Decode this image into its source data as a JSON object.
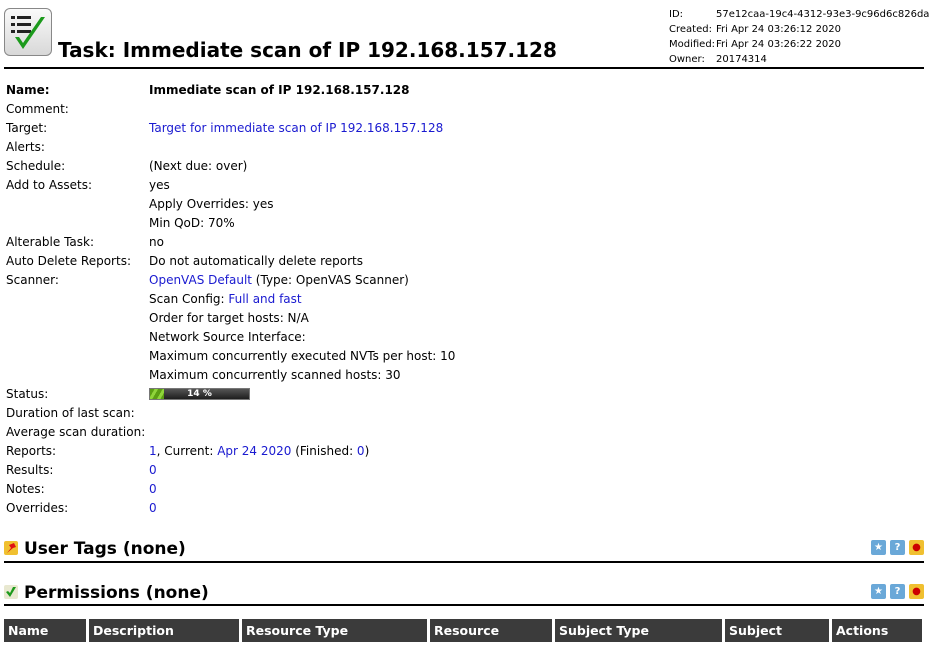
{
  "title": "Task: Immediate scan of IP 192.168.157.128",
  "meta": [
    {
      "label": "ID:",
      "value": "57e12caa-19c4-4312-93e3-9c96d6c826da"
    },
    {
      "label": "Created:",
      "value": "Fri Apr 24 03:26:12 2020"
    },
    {
      "label": "Modified:",
      "value": "Fri Apr 24 03:26:22 2020"
    },
    {
      "label": "Owner:",
      "value": "20174314"
    }
  ],
  "rows": [
    {
      "label": "Name:",
      "bold": true,
      "parts": [
        {
          "text": "Immediate scan of IP 192.168.157.128"
        }
      ]
    },
    {
      "label": "Comment:",
      "parts": []
    },
    {
      "label": "Target:",
      "parts": [
        {
          "text": "Target for immediate scan of IP 192.168.157.128",
          "link": true
        }
      ]
    },
    {
      "label": "Alerts:",
      "parts": []
    },
    {
      "label": "Schedule:",
      "parts": [
        {
          "text": "(Next due: over)"
        }
      ]
    },
    {
      "label": "Add to Assets:",
      "parts": [
        {
          "text": "yes"
        }
      ]
    },
    {
      "label": "",
      "parts": [
        {
          "text": "Apply Overrides: yes"
        }
      ]
    },
    {
      "label": "",
      "parts": [
        {
          "text": "Min QoD: 70%"
        }
      ]
    },
    {
      "label": "Alterable Task:",
      "parts": [
        {
          "text": "no"
        }
      ]
    },
    {
      "label": "Auto Delete Reports:",
      "parts": [
        {
          "text": "Do not automatically delete reports"
        }
      ]
    },
    {
      "label": "Scanner:",
      "parts": [
        {
          "text": "OpenVAS Default",
          "link": true
        },
        {
          "text": " (Type: OpenVAS Scanner)"
        }
      ]
    },
    {
      "label": "",
      "parts": [
        {
          "text": "Scan Config: "
        },
        {
          "text": "Full and fast",
          "link": true
        }
      ]
    },
    {
      "label": "",
      "parts": [
        {
          "text": "Order for target hosts: N/A"
        }
      ]
    },
    {
      "label": "",
      "parts": [
        {
          "text": "Network Source Interface:"
        }
      ]
    },
    {
      "label": "",
      "parts": [
        {
          "text": "Maximum concurrently executed NVTs per host: 10"
        }
      ]
    },
    {
      "label": "",
      "parts": [
        {
          "text": "Maximum concurrently scanned hosts: 30"
        }
      ]
    },
    {
      "label": "Status:",
      "parts": []
    },
    {
      "label": "Duration of last scan:",
      "parts": []
    },
    {
      "label": "Average scan duration:",
      "parts": []
    },
    {
      "label": "Reports:",
      "parts": [
        {
          "text": "1",
          "link": true
        },
        {
          "text": ", Current: "
        },
        {
          "text": "Apr 24 2020",
          "link": true
        },
        {
          "text": " (Finished: "
        },
        {
          "text": "0",
          "link": true
        },
        {
          "text": ")"
        }
      ]
    },
    {
      "label": "Results:",
      "parts": [
        {
          "text": "0",
          "link": true
        }
      ]
    },
    {
      "label": "Notes:",
      "parts": [
        {
          "text": "0",
          "link": true
        }
      ]
    },
    {
      "label": "Overrides:",
      "parts": [
        {
          "text": "0",
          "link": true
        }
      ]
    }
  ],
  "status": {
    "progress_percent": 14,
    "label": "14 %"
  },
  "sections": {
    "user_tags": "User Tags (none)",
    "permissions": "Permissions (none)"
  },
  "section_icons": [
    "new-icon",
    "help-icon",
    "export-icon"
  ],
  "permissions_columns": [
    "Name",
    "Description",
    "Resource Type",
    "Resource",
    "Subject Type",
    "Subject",
    "Actions"
  ],
  "colors": {
    "link": "#1a1ad0",
    "header_bg": "#3b3b3b",
    "progress": "#6ab820"
  }
}
